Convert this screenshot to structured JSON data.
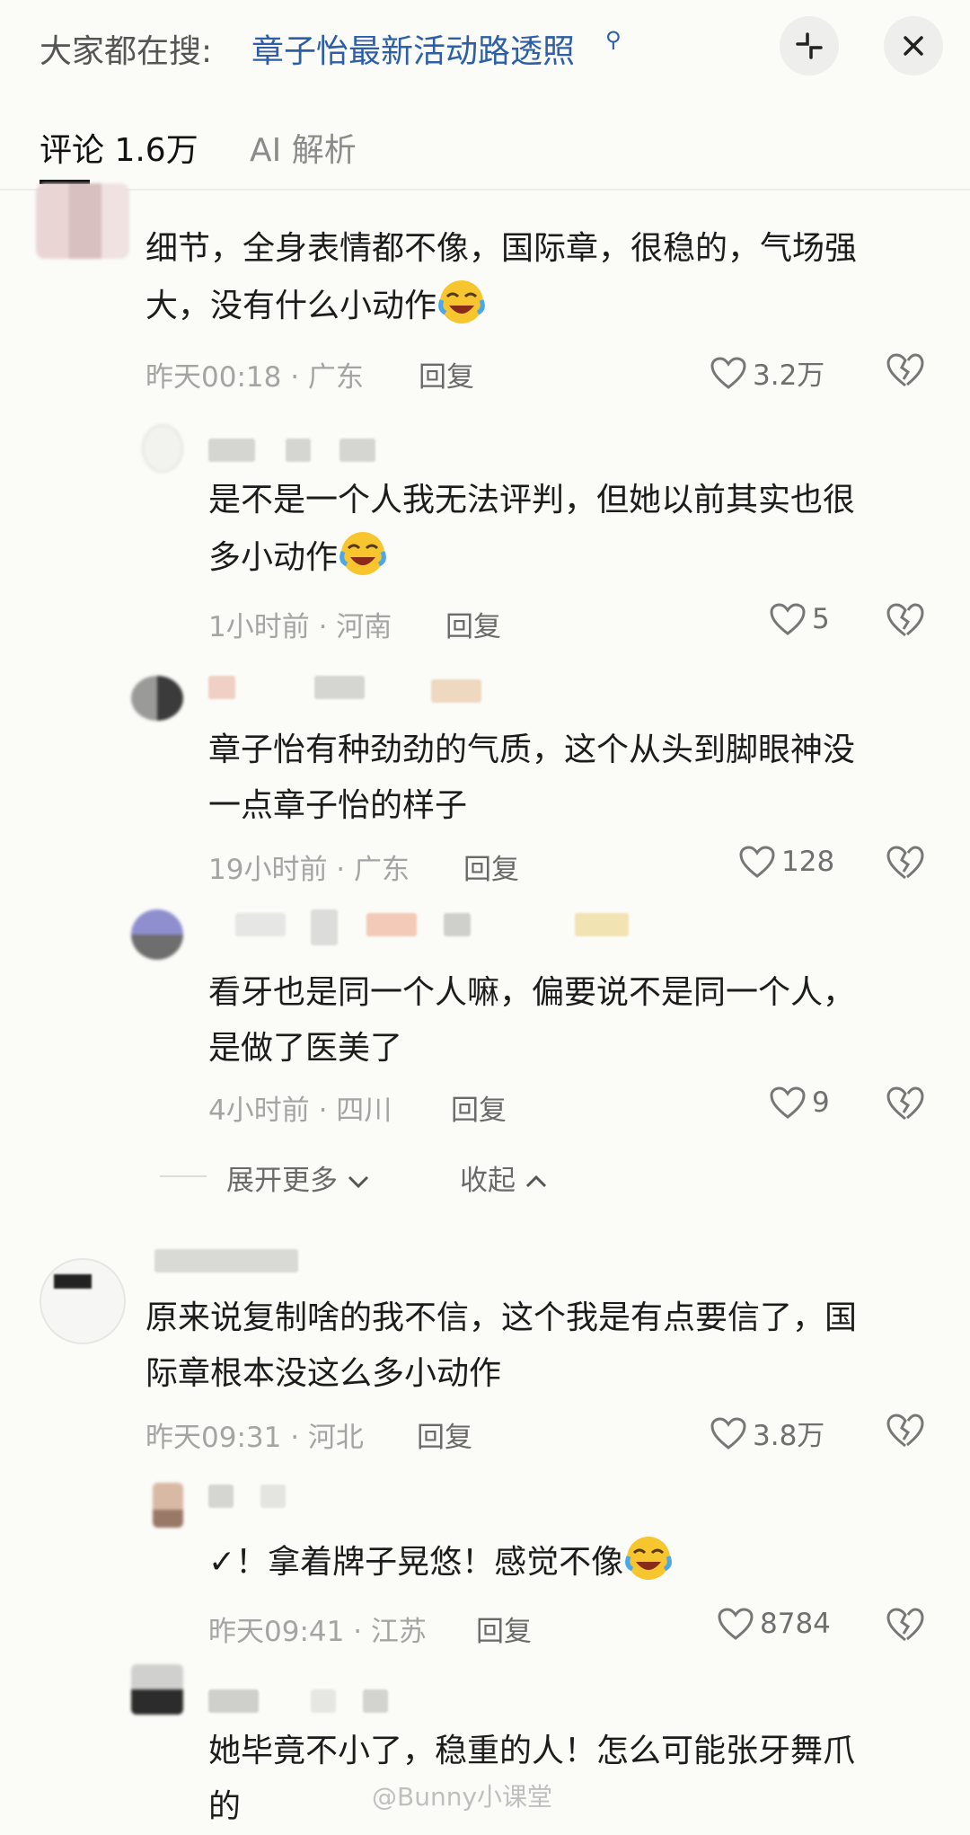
{
  "topbar": {
    "search_prefix": "大家都在搜:",
    "search_query": "章子怡最新活动路透照",
    "search_icon": "search-icon",
    "collapse_icon": "collapse-icon",
    "close_icon": "close-icon"
  },
  "tabs": [
    {
      "label": "评论 1.6万",
      "active": true
    },
    {
      "label": "AI 解析",
      "active": false
    }
  ],
  "comments": [
    {
      "line1": "细节，全身表情都不像，国际章，很稳的，气场强",
      "line2": "大，没有什么小动作",
      "time": "昨天00:18",
      "location": "广东",
      "reply": "回复",
      "likes": "3.2万"
    },
    {
      "line1": "是不是一个人我无法评判，但她以前其实也很",
      "line2": "多小动作",
      "time": "1小时前",
      "location": "河南",
      "reply": "回复",
      "likes": "5"
    },
    {
      "line1": "章子怡有种劲劲的气质，这个从头到脚眼神没",
      "line2": "一点章子怡的样子",
      "time": "19小时前",
      "location": "广东",
      "reply": "回复",
      "likes": "128"
    },
    {
      "line1": "看牙也是同一个人嘛，偏要说不是同一个人，",
      "line2": "是做了医美了",
      "time": "4小时前",
      "location": "四川",
      "reply": "回复",
      "likes": "9"
    },
    {
      "line1": "原来说复制啥的我不信，这个我是有点要信了，国",
      "line2": "际章根本没这么多小动作",
      "time": "昨天09:31",
      "location": "河北",
      "reply": "回复",
      "likes": "3.8万"
    },
    {
      "line1": "✓！拿着牌子晃悠！感觉不像",
      "line2": "",
      "time": "昨天09:41",
      "location": "江苏",
      "reply": "回复",
      "likes": "8784"
    },
    {
      "line1": "她毕竟不小了，稳重的人！怎么可能张牙舞爪",
      "line2": "的",
      "time": "",
      "location": "",
      "reply": "",
      "likes": ""
    }
  ],
  "expand": {
    "more": "展开更多",
    "collapse": "收起"
  },
  "watermark": "@Bunny小课堂"
}
